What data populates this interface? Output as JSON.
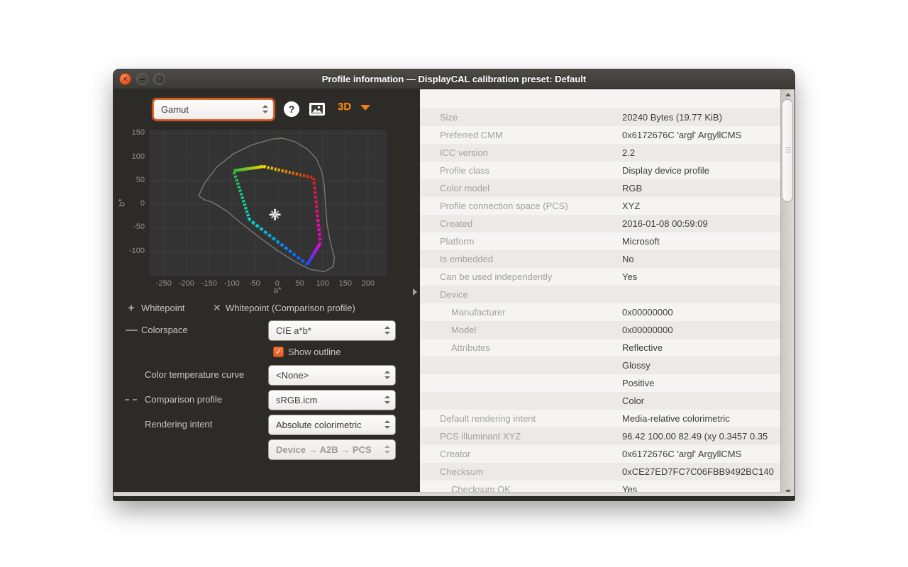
{
  "window": {
    "title": "Profile information — DisplayCAL calibration preset: Default",
    "buttons": {
      "close": "✕",
      "minimize": "minimize",
      "maximize": "maximize"
    }
  },
  "toolbar": {
    "plot_type_value": "Gamut",
    "help_label": "?",
    "image_button": "save-plot-image",
    "three_d_label": "3D"
  },
  "legend": {
    "whitepoint_label": "Whitepoint",
    "whitepoint_comparison_label": "Whitepoint (Comparison profile)",
    "colorspace_label": "Colorspace",
    "colorspace_value": "CIE a*b*",
    "show_outline_label": "Show outline",
    "show_outline_checked": true,
    "check_glyph": "✓",
    "color_temperature_label": "Color temperature curve",
    "color_temperature_value": "<None>",
    "comparison_profile_label": "Comparison profile",
    "comparison_profile_value": "sRGB.icm",
    "rendering_intent_label": "Rendering intent",
    "rendering_intent_value": "Absolute colorimetric",
    "direction_value": "Device → A2B → PCS"
  },
  "chart_data": {
    "type": "scatter",
    "title": "",
    "xlabel": "a*",
    "ylabel": "b*",
    "xlim": [
      -281,
      241
    ],
    "ylim": [
      -153,
      158
    ],
    "x_ticks": [
      -250,
      -200,
      -150,
      -100,
      -50,
      0,
      50,
      100,
      150,
      200
    ],
    "y_ticks": [
      150,
      100,
      50,
      0,
      -50,
      -100
    ],
    "grid": true,
    "colors": {
      "plot_bg": "#333333",
      "grid": "#403f3e",
      "outline": "#7f7f7f",
      "whitepoint_plus": "#f2f2f2",
      "whitepoint_cross": "#c4c4c4"
    },
    "whitepoint": {
      "a": -5,
      "b": -22
    },
    "gamut_vertices": [
      {
        "name": "green",
        "a": -96,
        "b": 71,
        "color": "#2ab83c"
      },
      {
        "name": "yellow",
        "a": -30,
        "b": 80,
        "color": "#f0dc00"
      },
      {
        "name": "red",
        "a": 80,
        "b": 56,
        "color": "#d42414"
      },
      {
        "name": "magenta",
        "a": 95,
        "b": -82,
        "color": "#f800d8"
      },
      {
        "name": "blue",
        "a": 66,
        "b": -128,
        "color": "#1850f8"
      },
      {
        "name": "cyan",
        "a": -61,
        "b": -33,
        "color": "#00d8c8"
      }
    ],
    "outline_points": [
      [
        -173,
        18
      ],
      [
        -160,
        45
      ],
      [
        -132,
        80
      ],
      [
        -96,
        107
      ],
      [
        -55,
        126
      ],
      [
        -12,
        138
      ],
      [
        12,
        140
      ],
      [
        40,
        132
      ],
      [
        66,
        117
      ],
      [
        86,
        97
      ],
      [
        98,
        70
      ],
      [
        104,
        38
      ],
      [
        106,
        5
      ],
      [
        110,
        -45
      ],
      [
        118,
        -85
      ],
      [
        126,
        -112
      ],
      [
        124,
        -132
      ],
      [
        104,
        -143
      ],
      [
        72,
        -138
      ],
      [
        40,
        -122
      ],
      [
        0,
        -98
      ],
      [
        -45,
        -66
      ],
      [
        -78,
        -41
      ],
      [
        -112,
        -14
      ],
      [
        -142,
        4
      ],
      [
        -162,
        10
      ]
    ]
  },
  "info_table": {
    "rows": [
      {
        "label": "",
        "value": "",
        "indent": 0
      },
      {
        "label": "Size",
        "value": "20240 Bytes (19.77 KiB)",
        "indent": 0
      },
      {
        "label": "Preferred CMM",
        "value": "0x6172676C 'argl' ArgyllCMS",
        "indent": 0
      },
      {
        "label": "ICC version",
        "value": "2.2",
        "indent": 0
      },
      {
        "label": "Profile class",
        "value": "Display device profile",
        "indent": 0
      },
      {
        "label": "Color model",
        "value": "RGB",
        "indent": 0
      },
      {
        "label": "Profile connection space (PCS)",
        "value": "XYZ",
        "indent": 0
      },
      {
        "label": "Created",
        "value": "2016-01-08 00:59:09",
        "indent": 0
      },
      {
        "label": "Platform",
        "value": "Microsoft",
        "indent": 0
      },
      {
        "label": "Is embedded",
        "value": "No",
        "indent": 0
      },
      {
        "label": "Can be used independently",
        "value": "Yes",
        "indent": 0
      },
      {
        "label": "Device",
        "value": "",
        "indent": 0,
        "expander": true
      },
      {
        "label": "Manufacturer",
        "value": "0x00000000",
        "indent": 1
      },
      {
        "label": "Model",
        "value": "0x00000000",
        "indent": 1
      },
      {
        "label": "Attributes",
        "value": "Reflective",
        "indent": 1
      },
      {
        "label": "",
        "value": "Glossy",
        "indent": 1
      },
      {
        "label": "",
        "value": "Positive",
        "indent": 1
      },
      {
        "label": "",
        "value": "Color",
        "indent": 1
      },
      {
        "label": "Default rendering intent",
        "value": "Media-relative colorimetric",
        "indent": 0
      },
      {
        "label": "PCS illuminant XYZ",
        "value": "96.42 100.00  82.49 (xy 0.3457 0.35",
        "indent": 0
      },
      {
        "label": "Creator",
        "value": "0x6172676C 'argl' ArgyllCMS",
        "indent": 0
      },
      {
        "label": "Checksum",
        "value": "0xCE27ED7FC7C06FBB9492BC140",
        "indent": 0
      },
      {
        "label": "Checksum OK",
        "value": "Yes",
        "indent": 1
      }
    ]
  }
}
